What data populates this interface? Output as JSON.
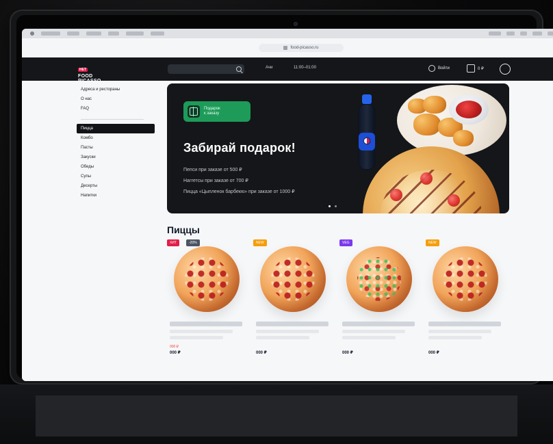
{
  "browser": {
    "url": "food-picasso.ru"
  },
  "site": {
    "logo": {
      "badge": "НЕТ",
      "line1": "FOOD",
      "line2": "PICASSO"
    },
    "header": {
      "search_placeholder": "",
      "city": "Ачи",
      "hours": "11:00–01:00",
      "login_label": "Войти",
      "cart_label": "0 ₽"
    },
    "sidebar": {
      "top_links": [
        {
          "label": "Адреса и рестораны"
        },
        {
          "label": "О нас"
        },
        {
          "label": "FAQ"
        }
      ],
      "categories": [
        {
          "label": "Пицца",
          "active": true
        },
        {
          "label": "Комбо",
          "active": false
        },
        {
          "label": "Пасты",
          "active": false
        },
        {
          "label": "Закуски",
          "active": false
        },
        {
          "label": "Обеды",
          "active": false
        },
        {
          "label": "Супы",
          "active": false
        },
        {
          "label": "Десерты",
          "active": false
        },
        {
          "label": "Напитки",
          "active": false
        }
      ]
    },
    "banner": {
      "promo_label_line1": "Подарок",
      "promo_label_line2": "к заказу",
      "title": "Забирай подарок!",
      "lines": [
        "Пепси при заказе от 500 ₽",
        "Наггетсы при заказе от 700 ₽",
        "Пицца «Цыпленок барбекю» при заказе от 1000 ₽"
      ]
    },
    "section": {
      "title": "Пиццы"
    },
    "products": [
      {
        "tags": [
          {
            "text": "ХИТ",
            "color": "red"
          },
          {
            "text": "-20%",
            "color": "gray"
          }
        ],
        "old_price": "000 ₽",
        "price": "000 ₽"
      },
      {
        "tags": [
          {
            "text": "NEW",
            "color": "orange"
          }
        ],
        "old_price": "",
        "price": "000 ₽"
      },
      {
        "tags": [
          {
            "text": "VEG",
            "color": "purple"
          }
        ],
        "old_price": "",
        "price": "000 ₽"
      },
      {
        "tags": [
          {
            "text": "NEW",
            "color": "orange"
          }
        ],
        "old_price": "",
        "price": "000 ₽"
      }
    ]
  },
  "colors": {
    "header_bg": "#14161a",
    "banner_bg": "#141619",
    "promo_green": "#1e9b59",
    "accent_red": "#e11d48",
    "tag_orange": "#f59e0b",
    "tag_purple": "#7c3aed"
  }
}
